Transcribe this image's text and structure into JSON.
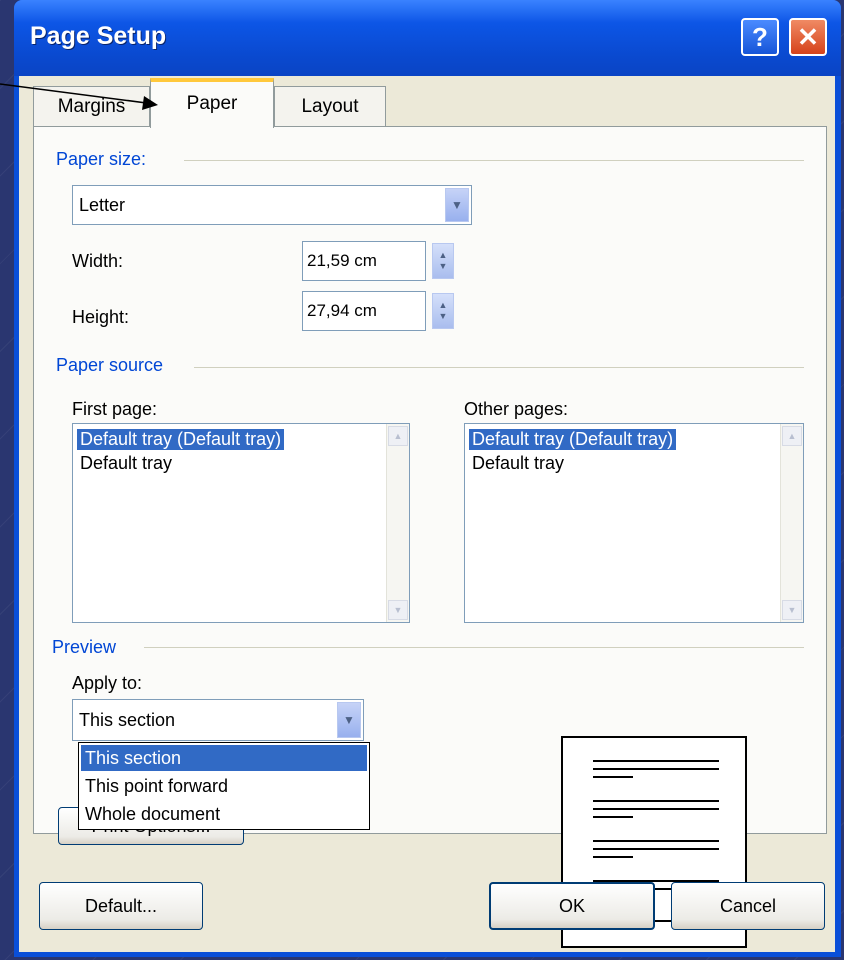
{
  "window": {
    "title": "Page Setup",
    "help_glyph": "?",
    "close_glyph": "✕"
  },
  "tabs": [
    {
      "label": "Margins"
    },
    {
      "label": "Paper"
    },
    {
      "label": "Layout"
    }
  ],
  "paper_size": {
    "group_label": "Paper size:",
    "selected": "Letter",
    "width_label": "Width:",
    "width_value": "21,59 cm",
    "height_label": "Height:",
    "height_value": "27,94 cm"
  },
  "paper_source": {
    "group_label": "Paper source",
    "first_page_label": "First page:",
    "first_page_items": [
      "Default tray (Default tray)",
      "Default tray"
    ],
    "other_pages_label": "Other pages:",
    "other_pages_items": [
      "Default tray (Default tray)",
      "Default tray"
    ]
  },
  "preview": {
    "group_label": "Preview",
    "apply_to_label": "Apply to:",
    "apply_to_value": "This section",
    "apply_to_options": [
      "This section",
      "This point forward",
      "Whole document"
    ]
  },
  "buttons": {
    "print_options": "Print Options...",
    "default": "Default...",
    "ok": "OK",
    "cancel": "Cancel"
  },
  "colors": {
    "titlebar": "#0a4fd8",
    "selection": "#316ac5",
    "group_label": "#0046d5"
  }
}
